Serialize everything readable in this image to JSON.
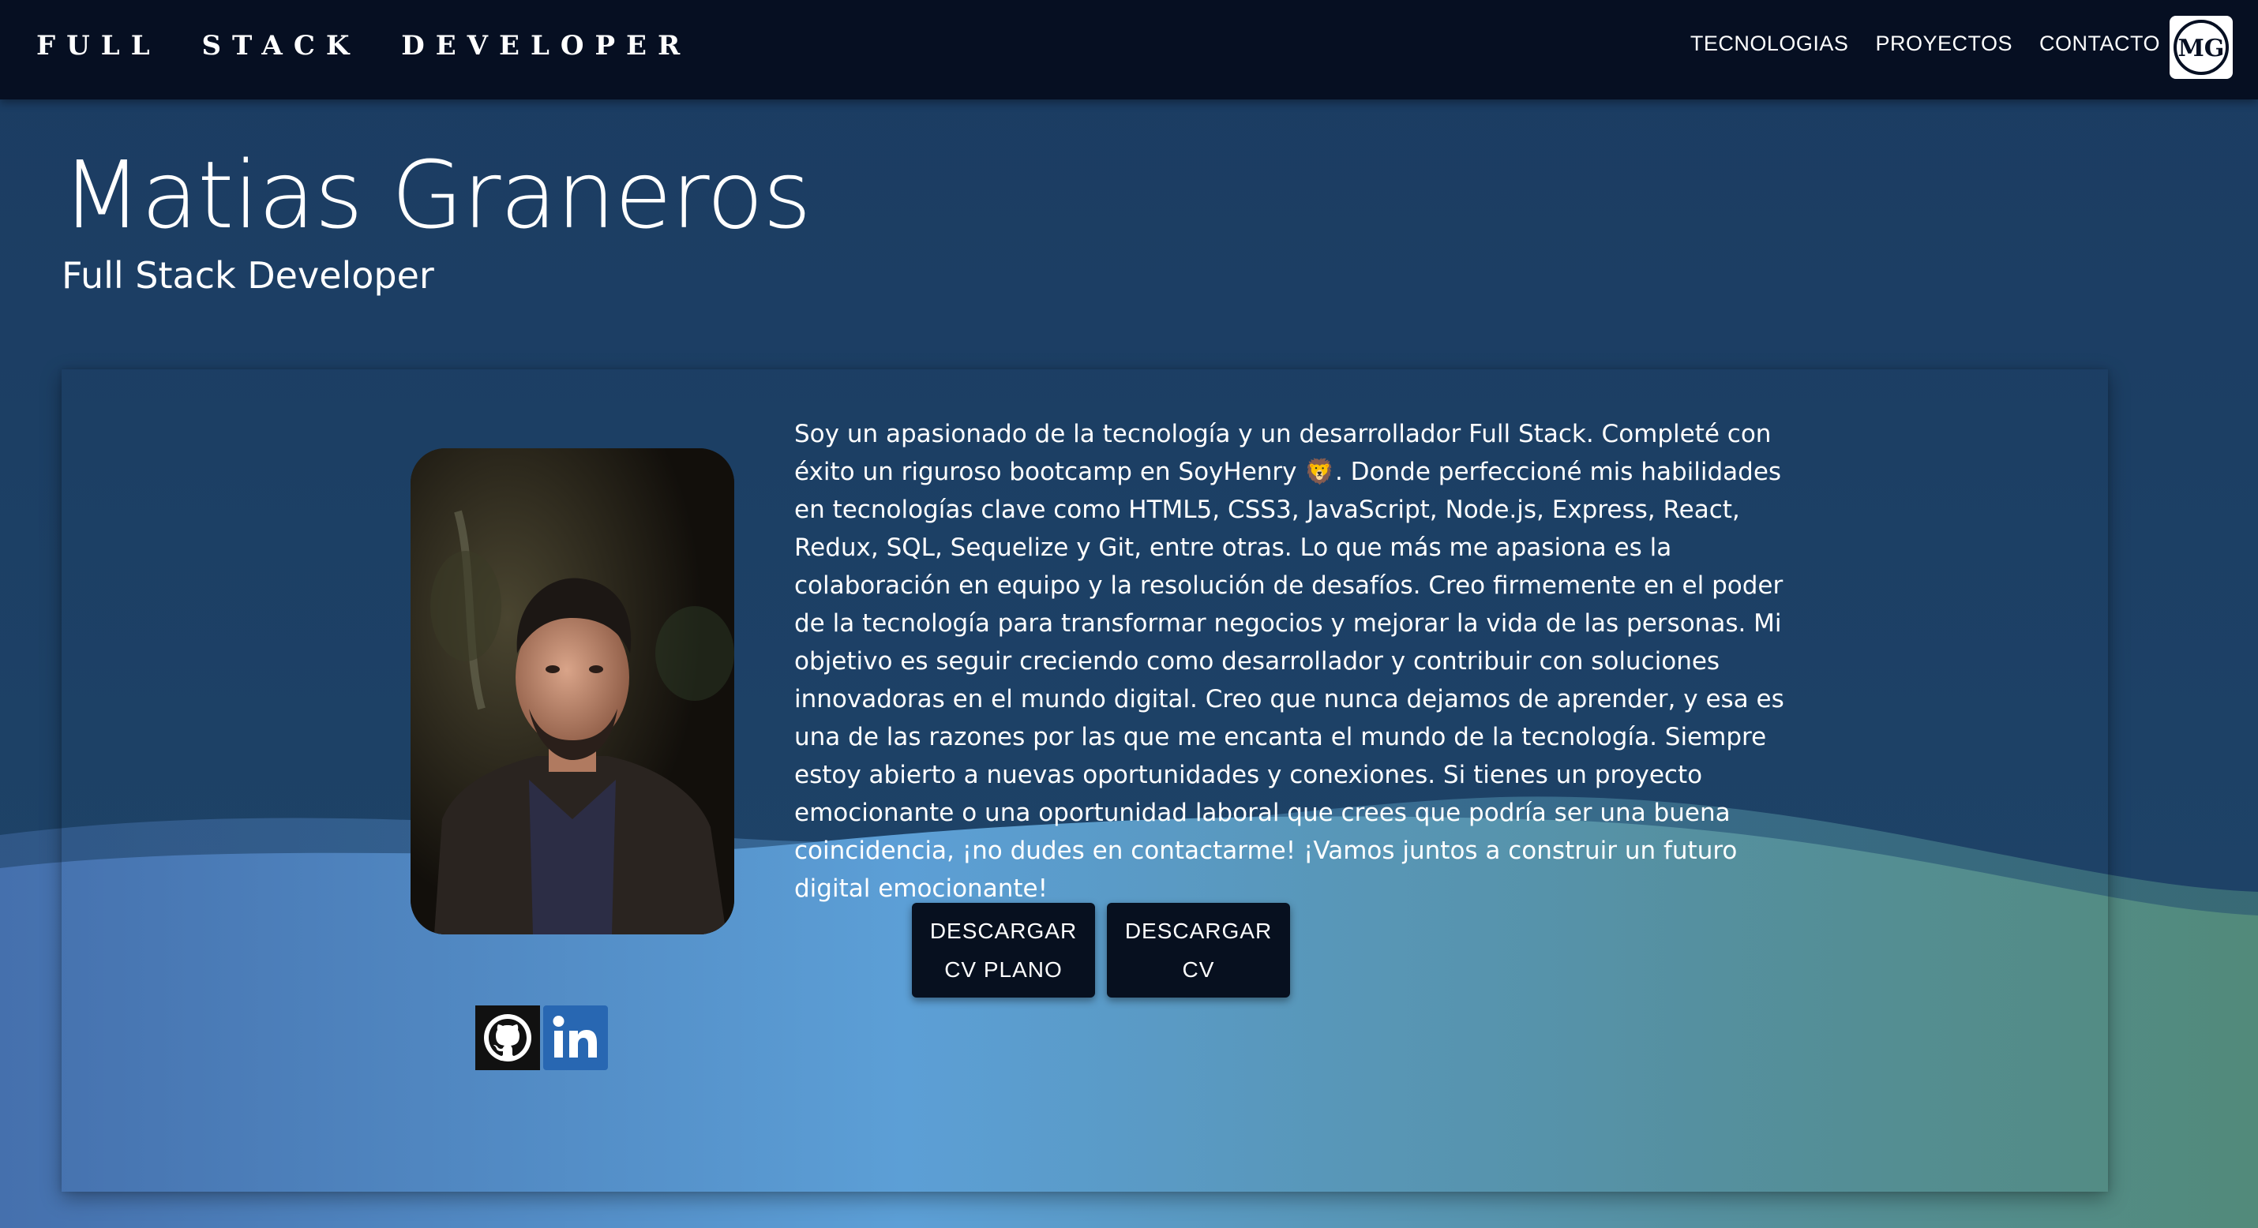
{
  "nav": {
    "brand": "FULL STACK DEVELOPER",
    "links": [
      "TECNOLOGIAS",
      "PROYECTOS",
      "CONTACTO"
    ],
    "logo_text": "MG"
  },
  "hero": {
    "name": "Matias Graneros",
    "subtitle": "Full Stack Developer"
  },
  "about": {
    "bio": "Soy un apasionado de la tecnología y un desarrollador Full Stack. Completé con éxito un riguroso bootcamp en SoyHenry 🦁. Donde perfeccioné mis habilidades en tecnologías clave como HTML5, CSS3, JavaScript, Node.js, Express, React, Redux, SQL, Sequelize y Git, entre otras. Lo que más me apasiona es la colaboración en equipo y la resolución de desafíos. Creo firmemente en el poder de la tecnología para transformar negocios y mejorar la vida de las personas. Mi objetivo es seguir creciendo como desarrollador y contribuir con soluciones innovadoras en el mundo digital. Creo que nunca dejamos de aprender, y esa es una de las razones por las que me encanta el mundo de la tecnología. Siempre estoy abierto a nuevas oportunidades y conexiones. Si tienes un proyecto emocionante o una oportunidad laboral que crees que podría ser una buena coincidencia, ¡no dudes en contactarme! ¡Vamos juntos a construir un futuro digital emocionante!",
    "buttons": {
      "cv_plain_line1": "DESCARGAR",
      "cv_plain_line2": "CV PLANO",
      "cv_line1": "DESCARGAR",
      "cv_line2": "CV"
    },
    "socials": [
      "github-icon",
      "linkedin-icon"
    ]
  },
  "colors": {
    "navbar": "#060f22",
    "background": "#1c3d63",
    "button": "#07101f",
    "linkedin": "#2867b2"
  }
}
